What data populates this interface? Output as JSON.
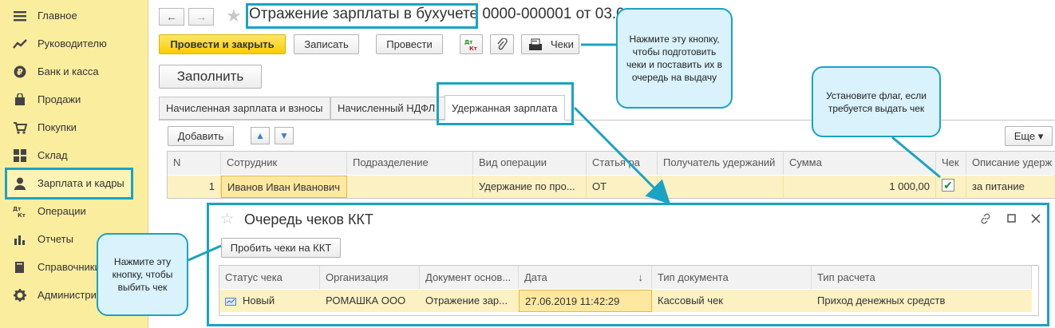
{
  "sidebar": {
    "items": [
      {
        "label": "Главное",
        "icon": "hamburger-icon"
      },
      {
        "label": "Руководителю",
        "icon": "trend-icon"
      },
      {
        "label": "Банк и касса",
        "icon": "coin-icon"
      },
      {
        "label": "Продажи",
        "icon": "bag-icon"
      },
      {
        "label": "Покупки",
        "icon": "cart-icon"
      },
      {
        "label": "Склад",
        "icon": "grid-icon"
      },
      {
        "label": "Зарплата и кадры",
        "icon": "person-icon"
      },
      {
        "label": "Операции",
        "icon": "dt-kt-icon"
      },
      {
        "label": "Отчеты",
        "icon": "bar-chart-icon"
      },
      {
        "label": "Справочники",
        "icon": "book-icon"
      },
      {
        "label": "Администри",
        "icon": "gear-icon"
      }
    ]
  },
  "header": {
    "title": "Отражение зарплаты в бухучете 0000-000001 от 03.0"
  },
  "toolbar": {
    "post_close": "Провести и закрыть",
    "save": "Записать",
    "post": "Провести",
    "dtkt": "Дт Кт",
    "checks": "Чеки",
    "fill": "Заполнить"
  },
  "tabs": [
    {
      "label": "Начисленная зарплата и взносы"
    },
    {
      "label": "Начисленный НДФЛ"
    },
    {
      "label": "Удержанная зарплата"
    }
  ],
  "table_toolbar": {
    "add": "Добавить",
    "more": "Еще ▾"
  },
  "table": {
    "columns": [
      "N",
      "Сотрудник",
      "Подразделение",
      "Вид операции",
      "Статья ра",
      "Получатель удержаний",
      "Сумма",
      "Чек",
      "Описание удерж"
    ],
    "rows": [
      {
        "n": "1",
        "employee": "Иванов Иван Иванович",
        "dept": "",
        "op": "Удержание по про...",
        "article": "ОТ",
        "recipient": "",
        "amount": "1 000,00",
        "check": true,
        "desc": "за питание"
      }
    ]
  },
  "popup": {
    "title": "Очередь чеков ККТ",
    "punch_button": "Пробить чеки на ККТ",
    "columns": [
      "Статус чека",
      "Организация",
      "Документ основ...",
      "Дата",
      "Тип документа",
      "Тип расчета"
    ],
    "sort_indicator": "↓",
    "rows": [
      {
        "status": "Новый",
        "org": "РОМАШКА ООО",
        "doc": "Отражение зар...",
        "date": "27.06.2019 11:42:29",
        "doc_type": "Кассовый чек",
        "calc_type": "Приход денежных средств"
      }
    ]
  },
  "callouts": {
    "checks_hint": "Нажмите эту кнопку, чтобы подготовить чеки и поставить их в очередь на выдачу",
    "flag_hint": "Установите флаг, если требуется выдать чек",
    "punch_hint": "Нажмите эту кнопку, чтобы выбить чек"
  },
  "colors": {
    "accent": "#1aa3c4",
    "sidebar_bg": "#fbed9e",
    "primary_btn": "#f7cf00",
    "row_highlight": "#fbf1c2"
  }
}
